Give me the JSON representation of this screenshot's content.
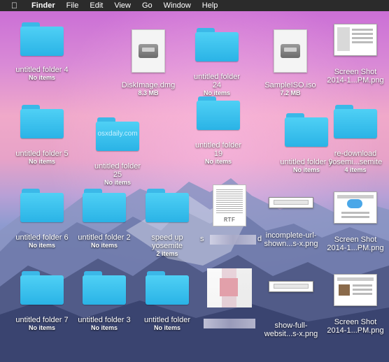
{
  "menubar": {
    "apple": "",
    "items": [
      "Finder",
      "File",
      "Edit",
      "View",
      "Go",
      "Window",
      "Help"
    ]
  },
  "desktop": [
    {
      "id": "uf4",
      "name": "untitled folder 4",
      "sub": "No items"
    },
    {
      "id": "diskimage",
      "name": "DiskImage.dmg",
      "sub": "8.3 MB"
    },
    {
      "id": "uf24",
      "name": "untitled folder 24",
      "sub": "No items"
    },
    {
      "id": "sampleiso",
      "name": "SampleISO.iso",
      "sub": "7.2 MB"
    },
    {
      "id": "ss1",
      "name": "Screen Shot 2014-1...PM.png",
      "sub": ""
    },
    {
      "id": "uf5",
      "name": "untitled folder 5",
      "sub": "No items"
    },
    {
      "id": "uf25",
      "name": "untitled folder 25",
      "sub": "No items",
      "folder_text": "osxdaily.com"
    },
    {
      "id": "uf19",
      "name": "untitled folder 19",
      "sub": "No items"
    },
    {
      "id": "uf9",
      "name": "untitled folder 9",
      "sub": "No items"
    },
    {
      "id": "redownload",
      "name": "re-download yosemi...semite",
      "sub": "4 items"
    },
    {
      "id": "uf6",
      "name": "untitled folder 6",
      "sub": "No items"
    },
    {
      "id": "uf2",
      "name": "untitled folder 2",
      "sub": "No items"
    },
    {
      "id": "speedup",
      "name": "speed up yosemite",
      "sub": "2 items"
    },
    {
      "id": "rtf",
      "name": "s",
      "sub": "",
      "icon_label": "RTF",
      "name_tail": "d"
    },
    {
      "id": "incomplete",
      "name": "incomplete-url-shown...s-x.png",
      "sub": ""
    },
    {
      "id": "ss2",
      "name": "Screen Shot 2014-1...PM.png",
      "sub": ""
    },
    {
      "id": "uf7",
      "name": "untitled folder 7",
      "sub": "No items"
    },
    {
      "id": "uf3",
      "name": "untitled folder 3",
      "sub": "No items"
    },
    {
      "id": "uf",
      "name": "untitled folder",
      "sub": "No items"
    },
    {
      "id": "blurred",
      "name": "",
      "sub": ""
    },
    {
      "id": "showfull",
      "name": "show-full-websit...s-x.png",
      "sub": ""
    },
    {
      "id": "ss3",
      "name": "Screen Shot 2014-1...PM.png",
      "sub": ""
    }
  ]
}
